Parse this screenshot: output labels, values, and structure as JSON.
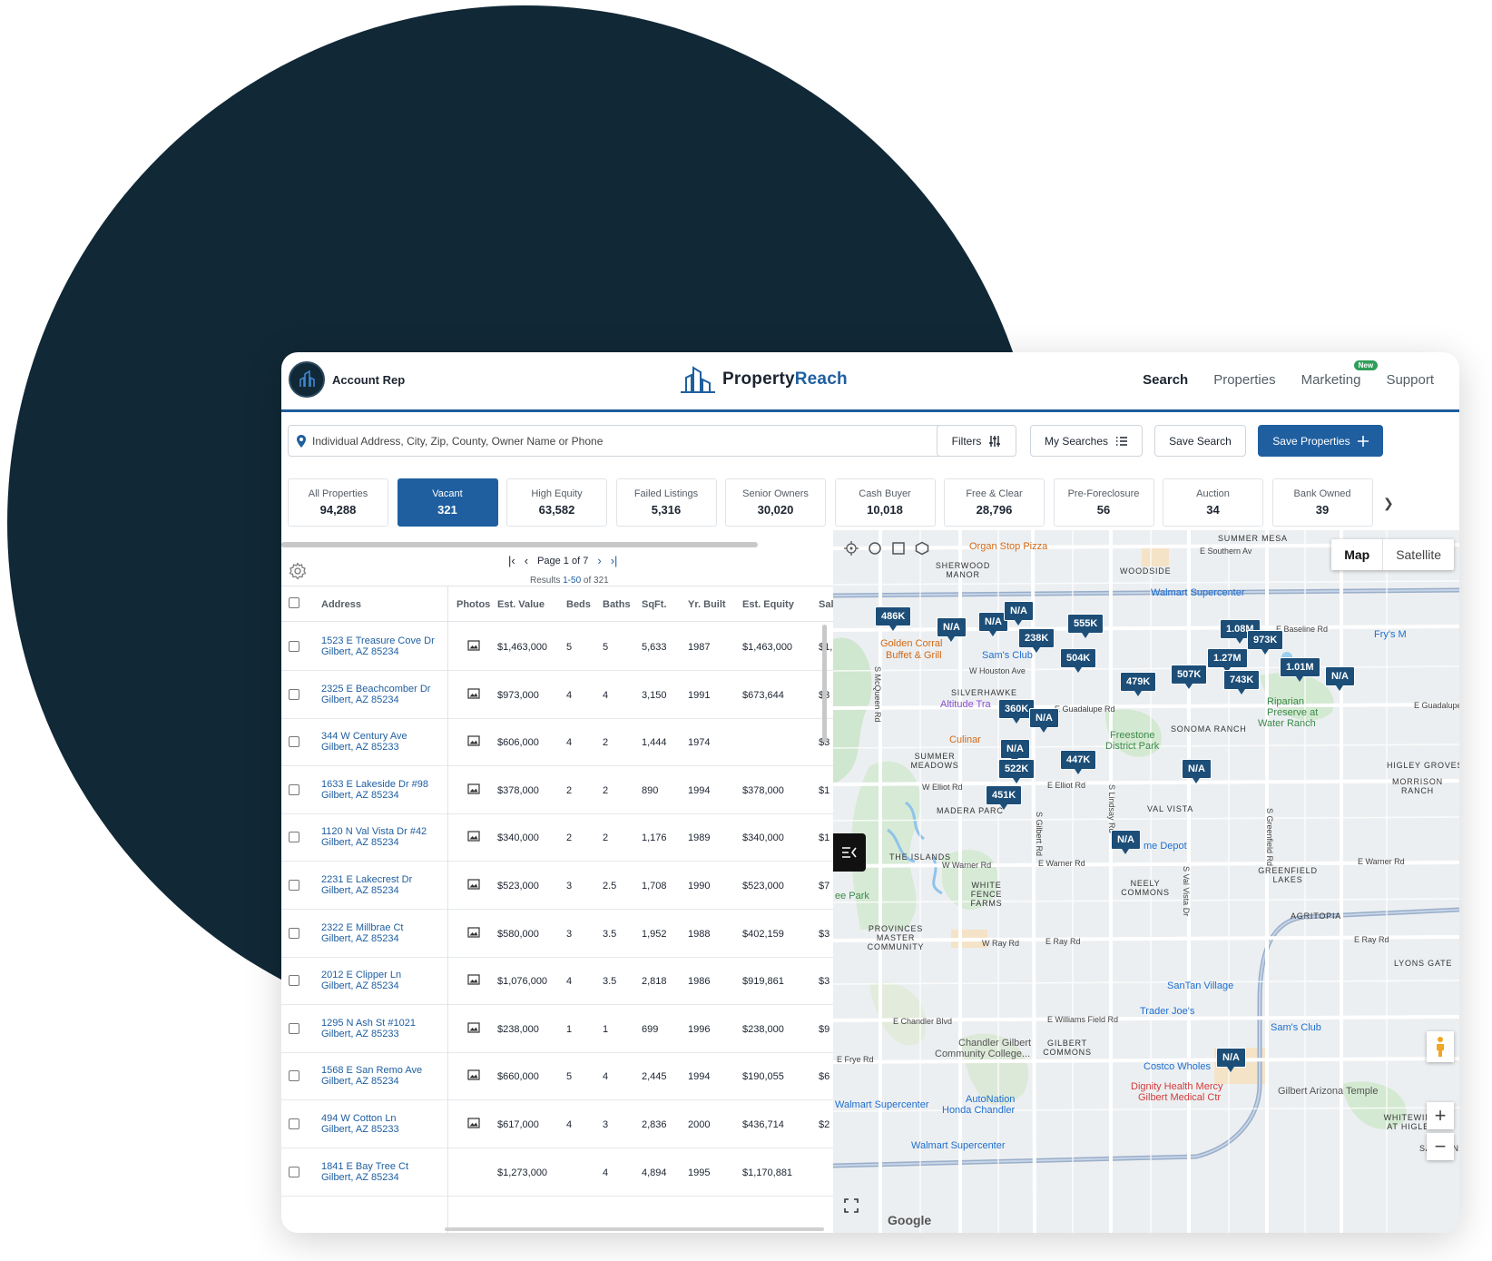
{
  "header": {
    "account_label": "Account Rep",
    "logo": {
      "part1": "Property",
      "part2": "Reach"
    },
    "nav": [
      {
        "label": "Search",
        "active": true
      },
      {
        "label": "Properties",
        "active": false
      },
      {
        "label": "Marketing",
        "active": false,
        "badge": "New"
      },
      {
        "label": "Support",
        "active": false
      }
    ]
  },
  "toolbar": {
    "search_placeholder": "Individual Address, City, Zip, County, Owner Name or Phone",
    "filters_label": "Filters",
    "my_searches_label": "My Searches",
    "save_search_label": "Save Search",
    "save_properties_label": "Save Properties"
  },
  "categories": [
    {
      "label": "All Properties",
      "count": "94,288"
    },
    {
      "label": "Vacant",
      "count": "321",
      "active": true
    },
    {
      "label": "High Equity",
      "count": "63,582"
    },
    {
      "label": "Failed Listings",
      "count": "5,316"
    },
    {
      "label": "Senior Owners",
      "count": "30,020"
    },
    {
      "label": "Cash Buyer",
      "count": "10,018"
    },
    {
      "label": "Free & Clear",
      "count": "28,796"
    },
    {
      "label": "Pre-Foreclosure",
      "count": "56"
    },
    {
      "label": "Auction",
      "count": "34"
    },
    {
      "label": "Bank Owned",
      "count": "39"
    }
  ],
  "pagination": {
    "page_text": "Page 1 of 7",
    "results_prefix": "Results ",
    "results_range": "1-50",
    "results_suffix": " of 321"
  },
  "table": {
    "columns": [
      "Address",
      "Photos",
      "Est. Value",
      "Beds",
      "Baths",
      "SqFt.",
      "Yr. Built",
      "Est. Equity",
      "Sale"
    ],
    "rows": [
      {
        "street": "1523 E Treasure Cove Dr",
        "city": "Gilbert,  AZ 85234",
        "value": "$1,463,000",
        "beds": "5",
        "baths": "5",
        "sqft": "5,633",
        "year": "1987",
        "equity": "$1,463,000",
        "sale": "$1,",
        "photo": true
      },
      {
        "street": "2325 E Beachcomber Dr",
        "city": "Gilbert,  AZ 85234",
        "value": "$973,000",
        "beds": "4",
        "baths": "4",
        "sqft": "3,150",
        "year": "1991",
        "equity": "$673,644",
        "sale": "$3",
        "photo": true
      },
      {
        "street": "344 W Century Ave",
        "city": "Gilbert,  AZ 85233",
        "value": "$606,000",
        "beds": "4",
        "baths": "2",
        "sqft": "1,444",
        "year": "1974",
        "equity": "",
        "sale": "$3",
        "photo": true
      },
      {
        "street": "1633 E Lakeside Dr #98",
        "city": "Gilbert,  AZ 85234",
        "value": "$378,000",
        "beds": "2",
        "baths": "2",
        "sqft": "890",
        "year": "1994",
        "equity": "$378,000",
        "sale": "$1",
        "photo": true
      },
      {
        "street": "1120 N Val Vista Dr #42",
        "city": "Gilbert,  AZ 85234",
        "value": "$340,000",
        "beds": "2",
        "baths": "2",
        "sqft": "1,176",
        "year": "1989",
        "equity": "$340,000",
        "sale": "$1",
        "photo": true
      },
      {
        "street": "2231 E Lakecrest Dr",
        "city": "Gilbert,  AZ 85234",
        "value": "$523,000",
        "beds": "3",
        "baths": "2.5",
        "sqft": "1,708",
        "year": "1990",
        "equity": "$523,000",
        "sale": "$7",
        "photo": true
      },
      {
        "street": "2322 E Millbrae Ct",
        "city": "Gilbert,  AZ 85234",
        "value": "$580,000",
        "beds": "3",
        "baths": "3.5",
        "sqft": "1,952",
        "year": "1988",
        "equity": "$402,159",
        "sale": "$3",
        "photo": true
      },
      {
        "street": "2012 E Clipper Ln",
        "city": "Gilbert,  AZ 85234",
        "value": "$1,076,000",
        "beds": "4",
        "baths": "3.5",
        "sqft": "2,818",
        "year": "1986",
        "equity": "$919,861",
        "sale": "$3",
        "photo": true
      },
      {
        "street": "1295 N Ash St #1021",
        "city": "Gilbert,  AZ 85233",
        "value": "$238,000",
        "beds": "1",
        "baths": "1",
        "sqft": "699",
        "year": "1996",
        "equity": "$238,000",
        "sale": "$9",
        "photo": true
      },
      {
        "street": "1568 E San Remo Ave",
        "city": "Gilbert,  AZ 85234",
        "value": "$660,000",
        "beds": "5",
        "baths": "4",
        "sqft": "2,445",
        "year": "1994",
        "equity": "$190,055",
        "sale": "$6",
        "photo": true
      },
      {
        "street": "494 W Cotton Ln",
        "city": "Gilbert,  AZ 85233",
        "value": "$617,000",
        "beds": "4",
        "baths": "3",
        "sqft": "2,836",
        "year": "2000",
        "equity": "$436,714",
        "sale": "$2",
        "photo": true
      },
      {
        "street": "1841 E Bay Tree Ct",
        "city": "Gilbert,  AZ 85234",
        "value": "$1,273,000",
        "beds": "",
        "baths": "4",
        "sqft": "4,894",
        "year": "1995",
        "equity": "$1,170,881",
        "sale": "",
        "photo": false
      }
    ]
  },
  "map": {
    "type_options": [
      "Map",
      "Satellite"
    ],
    "markers": [
      "486K",
      "N/A",
      "N/A",
      "N/A",
      "238K",
      "555K",
      "504K",
      "479K",
      "507K",
      "1.08M",
      "973K",
      "1.27M",
      "743K",
      "1.01M",
      "N/A",
      "360K",
      "N/A",
      "N/A",
      "447K",
      "522K",
      "451K",
      "N/A",
      "N/A",
      "N/A"
    ],
    "places": [
      {
        "text": "Organ Stop Pizza",
        "c": "orange"
      },
      {
        "text": "Walmart Supercenter",
        "c": "blue"
      },
      {
        "text": "Golden Corral",
        "c": "orange"
      },
      {
        "text": "Buffet & Grill",
        "c": "orange"
      },
      {
        "text": "Sam's Club",
        "c": "blue"
      },
      {
        "text": "Fry's M",
        "c": "blue"
      },
      {
        "text": "Altitude Tra",
        "c": "purple"
      },
      {
        "text": "Culinar",
        "c": "orange"
      },
      {
        "text": "Freestone",
        "c": "green"
      },
      {
        "text": "District Park",
        "c": "green"
      },
      {
        "text": "Riparian",
        "c": "green"
      },
      {
        "text": "Preserve at",
        "c": "green"
      },
      {
        "text": "Water Ranch",
        "c": "green"
      },
      {
        "text": "me Depot",
        "c": "blue"
      },
      {
        "text": "ee Park",
        "c": "green"
      },
      {
        "text": "SanTan Village",
        "c": "blue"
      },
      {
        "text": "Trader Joe's",
        "c": "blue"
      },
      {
        "text": "Sam's Club",
        "c": "blue"
      },
      {
        "text": "Costco Wholes",
        "c": "blue"
      },
      {
        "text": "Dignity Health Mercy",
        "c": "red"
      },
      {
        "text": "Gilbert Medical Ctr",
        "c": "red"
      },
      {
        "text": "Gilbert Arizona Temple",
        "c": "gray"
      },
      {
        "text": "Chandler Gilbert",
        "c": "gray"
      },
      {
        "text": "Community College...",
        "c": "gray"
      },
      {
        "text": "AutoNation",
        "c": "blue"
      },
      {
        "text": "Honda Chandler",
        "c": "blue"
      },
      {
        "text": "Walmart Supercenter",
        "c": "blue"
      },
      {
        "text": "Walmart Supercenter",
        "c": "blue"
      }
    ],
    "roads": [
      "E Southern Av",
      "E Baseline Rd",
      "W Houston Ave",
      "E Guadalupe Rd",
      "E Guadalupe",
      "W Elliot Rd",
      "E Elliot Rd",
      "W Warner Rd",
      "E Warner Rd",
      "E Warner Rd",
      "W Ray Rd",
      "E Ray Rd",
      "E Ray Rd",
      "E Chandler Blvd",
      "E Williams Field Rd",
      "E Frye Rd",
      "S McQueen Rd",
      "S Gilbert Rd",
      "S Val Vista Dr",
      "S Lindsay Rd",
      "S Greenfield Rd"
    ],
    "hoods": [
      "SUMMER MESA",
      "SHERWOOD MANOR",
      "WOODSIDE",
      "SILVERHAWKE",
      "SONOMA RANCH",
      "SUMMER MEADOWS",
      "HIGLEY GROVES",
      "MORRISON RANCH",
      "MADERA PARC",
      "VAL VISTA",
      "THE ISLANDS",
      "WHITE FENCE FARMS",
      "NEELY COMMONS",
      "GREENFIELD LAKES",
      "AGRITOPIA",
      "PROVINCES MASTER COMMUNITY",
      "LYONS GATE",
      "GILBERT COMMONS",
      "WHITEWING AT HIGLEY",
      "SAN TAN"
    ],
    "google_label": "Google",
    "colors": {
      "marker": "#1c4e78",
      "accent": "#1f5fa0"
    }
  }
}
